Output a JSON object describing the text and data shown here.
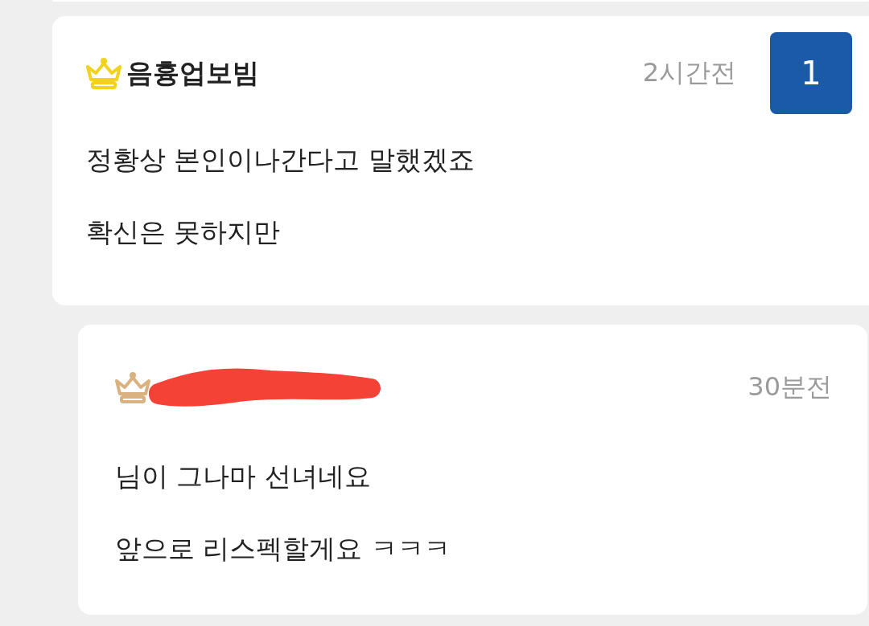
{
  "comments": [
    {
      "kind": "comment",
      "author": "음흉업보빔",
      "color": "#f2d21c",
      "redacted": false,
      "time": "2시간전",
      "badge": "1",
      "lines": [
        "정황상 본인이나간다고 말했겠죠",
        "확신은 못하지만"
      ]
    },
    {
      "kind": "reply",
      "color": "#d9b27f",
      "redacted": true,
      "time": "30분전",
      "lines": [
        "님이 그나마 선녀네요",
        "앞으로 리스펙할게요 ㅋㅋㅋ"
      ]
    }
  ]
}
